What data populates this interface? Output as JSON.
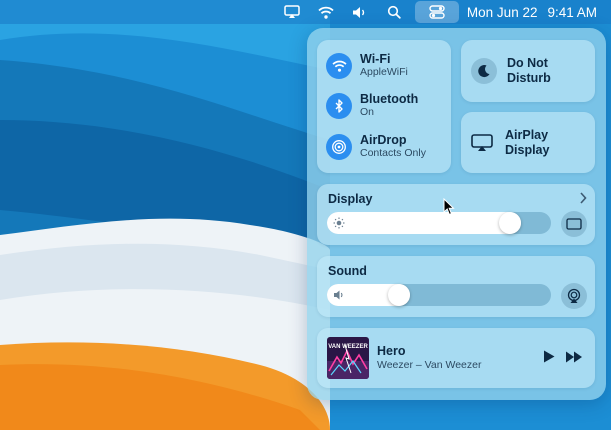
{
  "menubar": {
    "date": "Mon Jun 22",
    "time": "9:41 AM",
    "icons": [
      "airplay-icon",
      "wifi-icon",
      "volume-icon",
      "search-icon",
      "control-center-icon"
    ]
  },
  "control_center": {
    "wifi": {
      "title": "Wi-Fi",
      "status": "AppleWiFi"
    },
    "bluetooth": {
      "title": "Bluetooth",
      "status": "On"
    },
    "airdrop": {
      "title": "AirDrop",
      "status": "Contacts Only"
    },
    "do_not_disturb": {
      "line1": "Do Not",
      "line2": "Disturb"
    },
    "airplay_display": {
      "line1": "AirPlay",
      "line2": "Display"
    },
    "display": {
      "label": "Display",
      "brightness_percent": 85
    },
    "sound": {
      "label": "Sound",
      "volume_percent": 30
    },
    "now_playing": {
      "title": "Hero",
      "artist_album": "Weezer – Van Weezer",
      "album_art_text": "VAN WEEZER"
    }
  },
  "colors": {
    "accent_blue": "#2b8ef0",
    "panel": "#94d2ec",
    "wallpaper_orange": "#f39a2a"
  }
}
